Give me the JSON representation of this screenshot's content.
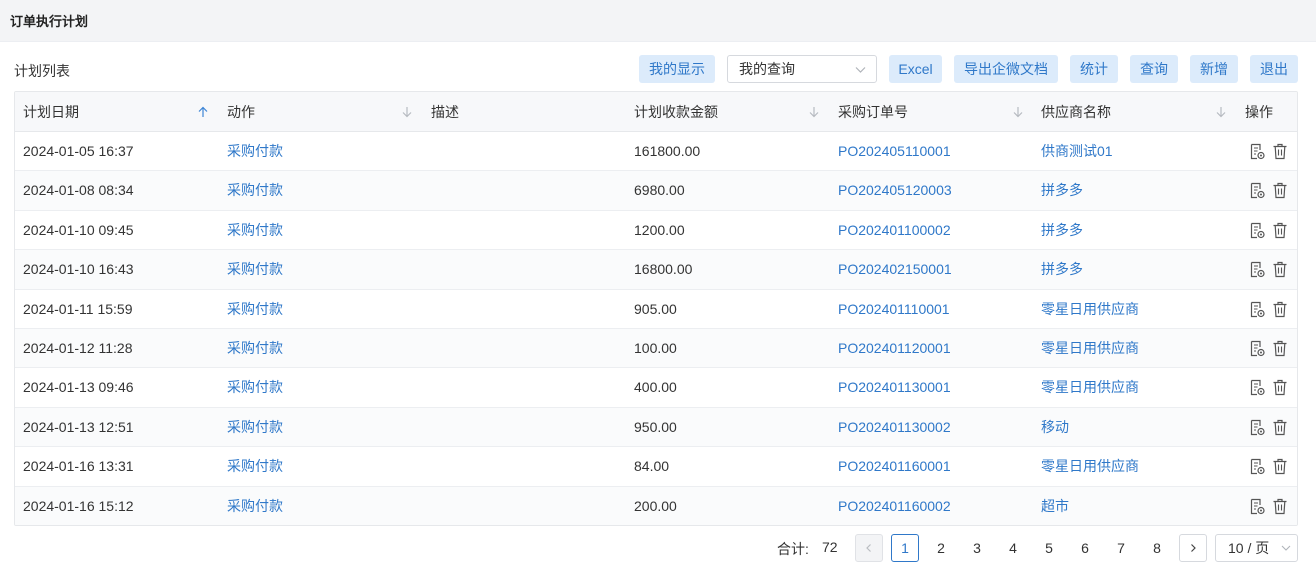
{
  "page": {
    "title": "订单执行计划"
  },
  "toolbar": {
    "list_title": "计划列表",
    "my_display": "我的显示",
    "query_select": "我的查询",
    "excel": "Excel",
    "export_wecom": "导出企微文档",
    "stats": "统计",
    "query": "查询",
    "add": "新增",
    "exit": "退出"
  },
  "table": {
    "columns": [
      "计划日期",
      "动作",
      "描述",
      "计划收款金额",
      "采购订单号",
      "供应商名称",
      "操作"
    ],
    "rows": [
      {
        "date": "2024-01-05 16:37",
        "action": "采购付款",
        "desc": "",
        "amount": "161800.00",
        "po": "PO202405110001",
        "supplier": "供商测试01"
      },
      {
        "date": "2024-01-08 08:34",
        "action": "采购付款",
        "desc": "",
        "amount": "6980.00",
        "po": "PO202405120003",
        "supplier": "拼多多"
      },
      {
        "date": "2024-01-10 09:45",
        "action": "采购付款",
        "desc": "",
        "amount": "1200.00",
        "po": "PO202401100002",
        "supplier": "拼多多"
      },
      {
        "date": "2024-01-10 16:43",
        "action": "采购付款",
        "desc": "",
        "amount": "16800.00",
        "po": "PO202402150001",
        "supplier": "拼多多"
      },
      {
        "date": "2024-01-11 15:59",
        "action": "采购付款",
        "desc": "",
        "amount": "905.00",
        "po": "PO202401110001",
        "supplier": "零星日用供应商"
      },
      {
        "date": "2024-01-12 11:28",
        "action": "采购付款",
        "desc": "",
        "amount": "100.00",
        "po": "PO202401120001",
        "supplier": "零星日用供应商"
      },
      {
        "date": "2024-01-13 09:46",
        "action": "采购付款",
        "desc": "",
        "amount": "400.00",
        "po": "PO202401130001",
        "supplier": "零星日用供应商"
      },
      {
        "date": "2024-01-13 12:51",
        "action": "采购付款",
        "desc": "",
        "amount": "950.00",
        "po": "PO202401130002",
        "supplier": "移动"
      },
      {
        "date": "2024-01-16 13:31",
        "action": "采购付款",
        "desc": "",
        "amount": "84.00",
        "po": "PO202401160001",
        "supplier": "零星日用供应商"
      },
      {
        "date": "2024-01-16 15:12",
        "action": "采购付款",
        "desc": "",
        "amount": "200.00",
        "po": "PO202401160002",
        "supplier": "超市"
      }
    ]
  },
  "pagination": {
    "total_label": "合计:",
    "total": "72",
    "pages": [
      "1",
      "2",
      "3",
      "4",
      "5",
      "6",
      "7",
      "8"
    ],
    "current": "1",
    "page_size": "10 / 页"
  },
  "icons": {
    "sort_asc": "arrow-up-icon",
    "sort_desc": "arrow-down-icon",
    "view": "document-view-icon",
    "delete": "trash-icon"
  },
  "colors": {
    "accent": "#2f78c9",
    "button_bg": "#dcebfb",
    "header_bg": "#f3f4f6"
  }
}
